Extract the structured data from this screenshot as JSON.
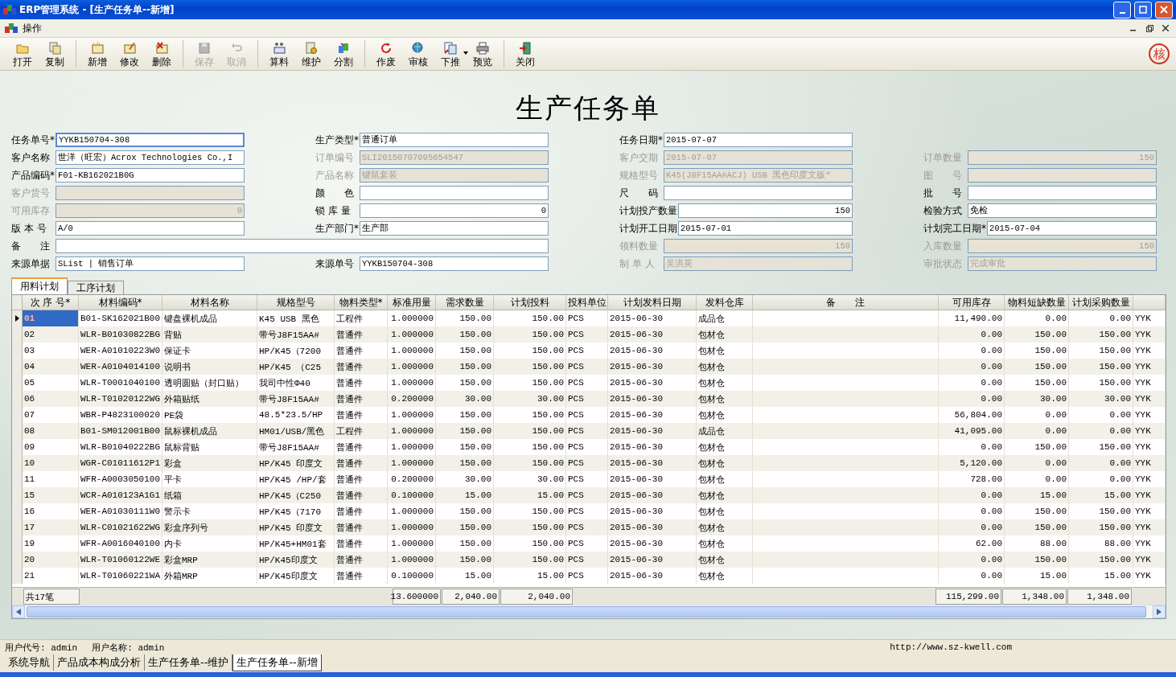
{
  "window": {
    "title": "ERP管理系统 - [生产任务单--新增]"
  },
  "menu": {
    "label": "操作"
  },
  "toolbar": [
    [
      {
        "label": "打开",
        "disabled": false
      },
      {
        "label": "复制",
        "disabled": false
      }
    ],
    [
      {
        "label": "新增",
        "disabled": false
      },
      {
        "label": "修改",
        "disabled": false
      },
      {
        "label": "删除",
        "disabled": false
      }
    ],
    [
      {
        "label": "保存",
        "disabled": true
      },
      {
        "label": "取消",
        "disabled": true
      }
    ],
    [
      {
        "label": "算料",
        "disabled": false
      },
      {
        "label": "维护",
        "disabled": false
      },
      {
        "label": "分割",
        "disabled": false
      }
    ],
    [
      {
        "label": "作废",
        "disabled": false
      },
      {
        "label": "审核",
        "disabled": false
      },
      {
        "label": "下推",
        "disabled": false,
        "has_menu": true
      },
      {
        "label": "预览",
        "disabled": false
      }
    ],
    [
      {
        "label": "关闭",
        "disabled": false
      }
    ]
  ],
  "stamp": "核",
  "form": {
    "title": "生产任务单",
    "rows": [
      [
        {
          "label": "任务单号*",
          "value": "YYKB150704-308",
          "kind": "text",
          "disabled": false,
          "focused": true
        },
        {
          "label": "生产类型*",
          "value": "普通订单",
          "kind": "text",
          "disabled": false,
          "focused": false
        },
        {
          "label": "任务日期*",
          "value": "2015-07-07",
          "kind": "text",
          "disabled": false,
          "focused": false
        },
        ""
      ],
      [
        {
          "label": "客户名称",
          "value": "世洋（旺宏）Acrox Technologies Co.,I",
          "kind": "text",
          "disabled": false,
          "focused": false
        },
        {
          "label": "订单编号",
          "value": "SLI20150707095654547",
          "kind": "text",
          "disabled": true,
          "focused": false
        },
        {
          "label": "客户交期",
          "value": "2015-07-07",
          "kind": "text",
          "disabled": true,
          "focused": false
        },
        {
          "label": "订单数量",
          "value": "150",
          "kind": "number",
          "disabled": true,
          "focused": false
        }
      ],
      [
        {
          "label": "产品编码*",
          "value": "F01-KB162021B0G",
          "kind": "text",
          "disabled": false,
          "focused": false
        },
        {
          "label": "产品名称",
          "value": "键鼠套装",
          "kind": "text",
          "disabled": true,
          "focused": false
        },
        {
          "label": "规格型号",
          "value": "K45(J8F15AA#ACJ) USB 黑色印度文版“",
          "kind": "text",
          "disabled": true,
          "focused": false
        },
        {
          "label": "图　　号",
          "kind": "text",
          "disabled": true,
          "focused": false
        }
      ],
      [
        {
          "label": "客户货号",
          "kind": "text",
          "disabled": true,
          "focused": false
        },
        {
          "label": "颜　　色",
          "kind": "text",
          "disabled": false,
          "focused": false
        },
        {
          "label": "尺　　码",
          "kind": "text",
          "disabled": false,
          "focused": false
        },
        {
          "label": "批　　号",
          "kind": "text",
          "disabled": false,
          "focused": false
        }
      ],
      [
        {
          "label": "可用库存",
          "value": "0",
          "kind": "number",
          "disabled": true,
          "focused": false
        },
        {
          "label": "锁 库 量",
          "value": "0",
          "kind": "number",
          "disabled": false,
          "focused": false
        },
        {
          "label": "计划投产数量",
          "value": "150",
          "kind": "number",
          "disabled": false,
          "focused": false
        },
        {
          "label": "检验方式",
          "value": "免检",
          "kind": "text",
          "disabled": false,
          "focused": false
        }
      ],
      [
        {
          "label": "版 本 号",
          "value": "A/0",
          "kind": "text",
          "disabled": false,
          "focused": false
        },
        {
          "label": "生产部门*",
          "value": "生产部",
          "kind": "text",
          "disabled": false,
          "focused": false
        },
        {
          "label": "计划开工日期",
          "value": "2015-07-01",
          "kind": "text",
          "disabled": false,
          "focused": false
        },
        {
          "label": "计划完工日期*",
          "value": "2015-07-04",
          "kind": "text",
          "disabled": false,
          "focused": false
        }
      ],
      [
        {
          "label": "备　　注",
          "kind": "wide",
          "disabled": false,
          "focused": false
        },
        "",
        {
          "label": "领料数量",
          "value": "150",
          "kind": "number",
          "disabled": true,
          "focused": false
        },
        {
          "label": "入库数量",
          "value": "150",
          "kind": "number",
          "disabled": true,
          "focused": false
        }
      ],
      [
        {
          "label": "来源单据",
          "value": "SList | 销售订单",
          "kind": "text",
          "disabled": false,
          "focused": false
        },
        {
          "label": "来源单号",
          "value": "YYKB150704-308",
          "kind": "text",
          "disabled": false,
          "focused": false
        },
        {
          "label": "制 单 人",
          "value": "吴洪英",
          "kind": "text",
          "disabled": true,
          "focused": false
        },
        {
          "label": "审批状态",
          "value": "完成审批",
          "kind": "text",
          "disabled": true,
          "focused": false
        }
      ]
    ]
  },
  "tabs": [
    {
      "label": "用料计划",
      "selected": true
    },
    {
      "label": "工序计划",
      "selected": false
    }
  ],
  "table": {
    "columns": [
      "次 序 号*",
      "材料编码*",
      "材料名称",
      "规格型号",
      "物料类型*",
      "标准用量",
      "需求数量",
      "计划投料",
      "投料单位",
      "计划发料日期",
      "发料仓库",
      "备　　注",
      "可用库存",
      "物料短缺数量",
      "计划采购数量"
    ],
    "rows": [
      {
        "selected": true,
        "cells": [
          "01",
          "B01-SK162021B00",
          "键盘裸机成品",
          "K45 USB 黑色",
          "工程件",
          "1.000000",
          "150.00",
          "150.00",
          "PCS",
          "2015-06-30",
          "成品仓",
          null,
          "11,490.00",
          "0.00",
          "0.00",
          "YYK"
        ]
      },
      {
        "selected": false,
        "cells": [
          "02",
          "WLR-B01030822BG",
          "背贴",
          "带号J8F15AA#",
          "普通件",
          "1.000000",
          "150.00",
          "150.00",
          "PCS",
          "2015-06-30",
          "包材仓",
          null,
          "0.00",
          "150.00",
          "150.00",
          "YYK"
        ]
      },
      {
        "selected": false,
        "cells": [
          "03",
          "WER-A01010223W0",
          "保证卡",
          "HP/K45（7200",
          "普通件",
          "1.000000",
          "150.00",
          "150.00",
          "PCS",
          "2015-06-30",
          "包材仓",
          null,
          "0.00",
          "150.00",
          "150.00",
          "YYK"
        ]
      },
      {
        "selected": false,
        "cells": [
          "04",
          "WER-A0104014100",
          "说明书",
          "HP/K45 （C25",
          "普通件",
          "1.000000",
          "150.00",
          "150.00",
          "PCS",
          "2015-06-30",
          "包材仓",
          null,
          "0.00",
          "150.00",
          "150.00",
          "YYK"
        ]
      },
      {
        "selected": false,
        "cells": [
          "05",
          "WLR-T0001040100",
          "透明圆贴（封口贴）",
          "我司中性Φ40",
          "普通件",
          "1.000000",
          "150.00",
          "150.00",
          "PCS",
          "2015-06-30",
          "包材仓",
          null,
          "0.00",
          "150.00",
          "150.00",
          "YYK"
        ]
      },
      {
        "selected": false,
        "cells": [
          "06",
          "WLR-T01020122WG",
          "外箱贴纸",
          "带号J8F15AA#",
          "普通件",
          "0.200000",
          "30.00",
          "30.00",
          "PCS",
          "2015-06-30",
          "包材仓",
          null,
          "0.00",
          "30.00",
          "30.00",
          "YYK"
        ]
      },
      {
        "selected": false,
        "cells": [
          "07",
          "WBR-P4823100020",
          "PE袋",
          "48.5*23.5/HP",
          "普通件",
          "1.000000",
          "150.00",
          "150.00",
          "PCS",
          "2015-06-30",
          "包材仓",
          null,
          "56,804.00",
          "0.00",
          "0.00",
          "YYK"
        ]
      },
      {
        "selected": false,
        "cells": [
          "08",
          "B01-SM012001B00",
          "鼠标裸机成品",
          "HM01/USB/黑色",
          "工程件",
          "1.000000",
          "150.00",
          "150.00",
          "PCS",
          "2015-06-30",
          "成品仓",
          null,
          "41,095.00",
          "0.00",
          "0.00",
          "YYK"
        ]
      },
      {
        "selected": false,
        "cells": [
          "09",
          "WLR-B01040222BG",
          "鼠标背贴",
          "带号J8F15AA#",
          "普通件",
          "1.000000",
          "150.00",
          "150.00",
          "PCS",
          "2015-06-30",
          "包材仓",
          null,
          "0.00",
          "150.00",
          "150.00",
          "YYK"
        ]
      },
      {
        "selected": false,
        "cells": [
          "10",
          "WGR-C01011612P1",
          "彩盒",
          "HP/K45 印度文",
          "普通件",
          "1.000000",
          "150.00",
          "150.00",
          "PCS",
          "2015-06-30",
          "包材仓",
          null,
          "5,120.00",
          "0.00",
          "0.00",
          "YYK"
        ]
      },
      {
        "selected": false,
        "cells": [
          "11",
          "WFR-A0003050100",
          "平卡",
          "HP/K45 /HP/套",
          "普通件",
          "0.200000",
          "30.00",
          "30.00",
          "PCS",
          "2015-06-30",
          "包材仓",
          null,
          "728.00",
          "0.00",
          "0.00",
          "YYK"
        ]
      },
      {
        "selected": false,
        "cells": [
          "15",
          "WCR-A010123A1G1",
          "纸箱",
          "HP/K45（C250",
          "普通件",
          "0.100000",
          "15.00",
          "15.00",
          "PCS",
          "2015-06-30",
          "包材仓",
          null,
          "0.00",
          "15.00",
          "15.00",
          "YYK"
        ]
      },
      {
        "selected": false,
        "cells": [
          "16",
          "WER-A01030111W0",
          "警示卡",
          "HP/K45（7170",
          "普通件",
          "1.000000",
          "150.00",
          "150.00",
          "PCS",
          "2015-06-30",
          "包材仓",
          null,
          "0.00",
          "150.00",
          "150.00",
          "YYK"
        ]
      },
      {
        "selected": false,
        "cells": [
          "17",
          "WLR-C01021622WG",
          "彩盒序列号",
          "HP/K45 印度文",
          "普通件",
          "1.000000",
          "150.00",
          "150.00",
          "PCS",
          "2015-06-30",
          "包材仓",
          null,
          "0.00",
          "150.00",
          "150.00",
          "YYK"
        ]
      },
      {
        "selected": false,
        "cells": [
          "19",
          "WFR-A0016040100",
          "内卡",
          "HP/K45+HM01套",
          "普通件",
          "1.000000",
          "150.00",
          "150.00",
          "PCS",
          "2015-06-30",
          "包材仓",
          null,
          "62.00",
          "88.00",
          "88.00",
          "YYK"
        ]
      },
      {
        "selected": false,
        "cells": [
          "20",
          "WLR-T01060122WE",
          "彩盒MRP",
          "HP/K45印度文",
          "普通件",
          "1.000000",
          "150.00",
          "150.00",
          "PCS",
          "2015-06-30",
          "包材仓",
          null,
          "0.00",
          "150.00",
          "150.00",
          "YYK"
        ]
      },
      {
        "selected": false,
        "cells": [
          "21",
          "WLR-T01060221WA",
          "外箱MRP",
          "HP/K45印度文",
          "普通件",
          "0.100000",
          "15.00",
          "15.00",
          "PCS",
          "2015-06-30",
          "包材仓",
          null,
          "0.00",
          "15.00",
          "15.00",
          "YYK"
        ]
      }
    ],
    "footer": {
      "record_count": "共17笔",
      "standard_usage_total": "13.600000",
      "demand_total": "2,040.00",
      "planned_feed_total": "2,040.00",
      "available_stock_total": "115,299.00",
      "shortage_total": "1,348.00",
      "planned_purchase_total": "1,348.00"
    }
  },
  "status_bar": {
    "user_code": "用户代号: admin",
    "user_name": "用户名称: admin",
    "url": "http://www.sz-kwell.com"
  },
  "window_tabs": [
    {
      "label": "系统导航",
      "selected": false
    },
    {
      "label": "产品成本构成分析",
      "selected": false
    },
    {
      "label": "生产任务单--维护",
      "selected": false
    },
    {
      "label": "生产任务单--新增",
      "selected": true
    }
  ]
}
